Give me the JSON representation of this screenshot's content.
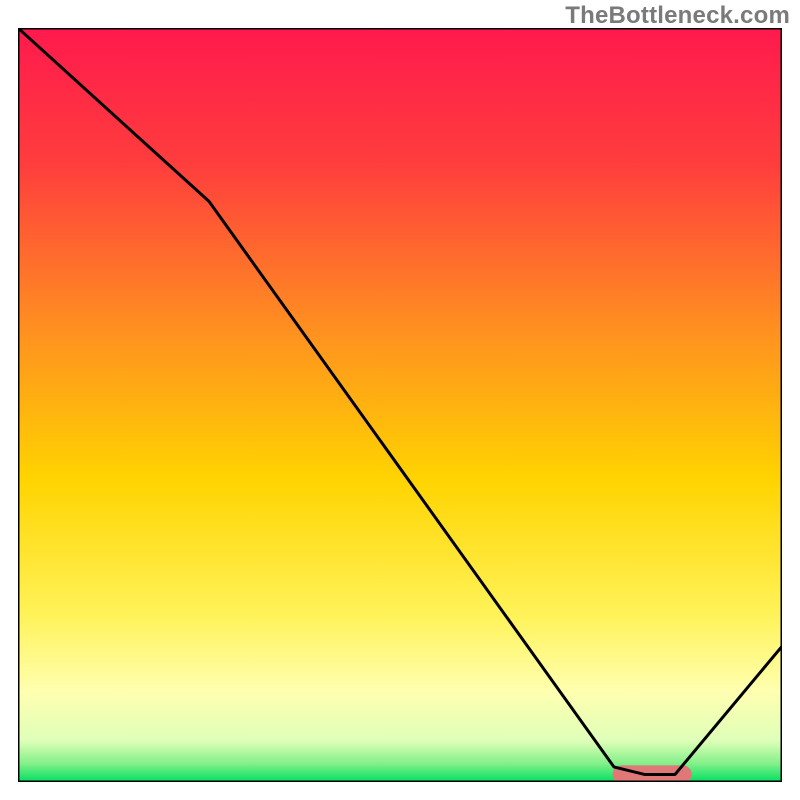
{
  "watermark": "TheBottleneck.com",
  "chart_data": {
    "type": "line",
    "title": "",
    "xlabel": "",
    "ylabel": "",
    "xlim": [
      0,
      100
    ],
    "ylim": [
      0,
      100
    ],
    "grid": false,
    "legend": null,
    "background_gradient_stops": [
      {
        "offset": 0.0,
        "color": "#ff1a4d"
      },
      {
        "offset": 0.18,
        "color": "#ff3d3d"
      },
      {
        "offset": 0.4,
        "color": "#ff9020"
      },
      {
        "offset": 0.6,
        "color": "#ffd400"
      },
      {
        "offset": 0.78,
        "color": "#fff35a"
      },
      {
        "offset": 0.88,
        "color": "#ffffb0"
      },
      {
        "offset": 0.945,
        "color": "#dfffb8"
      },
      {
        "offset": 0.975,
        "color": "#86f08a"
      },
      {
        "offset": 1.0,
        "color": "#00e060"
      }
    ],
    "series": [
      {
        "name": "bottleneck-curve",
        "x": [
          0,
          25,
          78,
          82,
          86,
          100
        ],
        "values": [
          100,
          77,
          2,
          1,
          1,
          18
        ]
      }
    ],
    "marker": {
      "name": "optimal-range",
      "x0": 79,
      "x1": 87,
      "y": 1,
      "color": "#e07878",
      "radius_pct": 1.2
    }
  }
}
